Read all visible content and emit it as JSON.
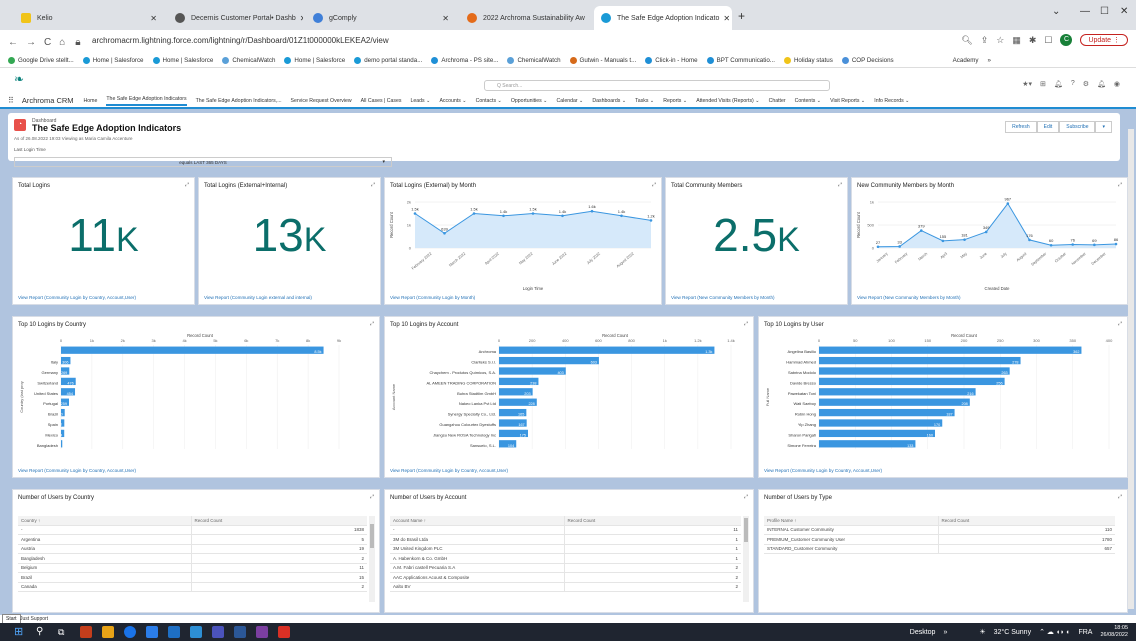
{
  "browser": {
    "tabs": [
      {
        "title": "Kelio",
        "icon": "kelio-icon",
        "color": "#f0c419"
      },
      {
        "title": "Decernis Customer Portal• Dashb",
        "icon": "decernis-icon",
        "color": "#555555"
      },
      {
        "title": "gComply",
        "icon": "gcomply-icon",
        "color": "#3f7fd8"
      },
      {
        "title": "2022 Archroma Sustainability Aw",
        "icon": "archroma-award-icon",
        "color": "#e46b1a"
      },
      {
        "title": "The Safe Edge Adoption Indicato",
        "icon": "salesforce-icon",
        "color": "#1a9ad6"
      }
    ],
    "url": "archromacrm.lightning.force.com/lightning/r/Dashboard/01Z1t000000kLEKEA2/view",
    "update_label": "Update",
    "profile_initial": "C",
    "bookmarks": [
      {
        "label": "Google Drive stellt...",
        "color": "#34a853"
      },
      {
        "label": "Home | Salesforce",
        "color": "#1a9ad6"
      },
      {
        "label": "Home | Salesforce",
        "color": "#1a9ad6"
      },
      {
        "label": "ChemicalWatch",
        "color": "#5aa0d8"
      },
      {
        "label": "Home | Salesforce",
        "color": "#1a9ad6"
      },
      {
        "label": "demo portal standa...",
        "color": "#1a9ad6"
      },
      {
        "label": "Archroma - PS site...",
        "color": "#1f8fd6"
      },
      {
        "label": "ChemicalWatch",
        "color": "#5aa0d8"
      },
      {
        "label": "Gutwin - Manuals t...",
        "color": "#d66a1a"
      },
      {
        "label": "Click-in - Home",
        "color": "#1f8fd6"
      },
      {
        "label": "BPT Communicatio...",
        "color": "#1f8fd6"
      },
      {
        "label": "Holiday status",
        "color": "#f0c419"
      },
      {
        "label": "COP Decisions",
        "color": "#4a90d9"
      },
      {
        "label": "Academy",
        "color": "#ffffff"
      }
    ]
  },
  "crm": {
    "search_placeholder": "Q Search...",
    "app_name": "Archroma CRM",
    "nav": [
      "Home",
      "The Safe Edge Adoption Indicators",
      "The Safe Edge Adoption Indicators,...",
      "Service Request Overview",
      "All Cases | Cases",
      "Leads",
      "Accounts",
      "Contacts",
      "Opportunities",
      "Calendar",
      "Dashboards",
      "Tasks",
      "Reports",
      "Attended Visits (Reports)",
      "Chatter",
      "Contents",
      "Visit Reports",
      "Info Records"
    ]
  },
  "dashboard": {
    "kicker": "Dashboard",
    "title": "The Safe Edge Adoption Indicators",
    "subtitle": "As of 26.08.2022 19:03 Viewing as Maria Camila Accenture",
    "filter_label": "Last Login Time",
    "filter_value": "equals LAST 365 DAYS",
    "buttons": [
      "Refresh",
      "Edit",
      "Subscribe"
    ]
  },
  "kpis": [
    {
      "title": "Total Logins",
      "value": "11",
      "unit": "K",
      "link": "View Report (Community Login by Country, Account,User)"
    },
    {
      "title": "Total Logins (External+Internal)",
      "value": "13",
      "unit": "K",
      "link": "View Report (Community Login external and internal)"
    },
    {
      "title": "Total Community Members",
      "value": "2.5",
      "unit": "K",
      "link": "View Report (New Community Members by Month)"
    }
  ],
  "chart_data": [
    {
      "type": "area",
      "title": "Total Logins (External) by Month",
      "xlabel": "Login Time",
      "ylabel": "Record Count",
      "ytick_labels": [
        "0",
        "1k",
        "2k"
      ],
      "categories": [
        "February 2022",
        "March 2022",
        "April 2022",
        "May 2022",
        "June 2022",
        "July 2022",
        "August 2022"
      ],
      "data_labels": [
        "1.5k",
        "639",
        "1.5k",
        "1.4k",
        "1.5k",
        "1.4k",
        "1.6k",
        "1.4k",
        "1.2k"
      ],
      "values": [
        1500,
        639,
        1500,
        1400,
        1500,
        1400,
        1600,
        1400,
        1200
      ],
      "ylim": [
        0,
        2000
      ],
      "link": "View Report (Community Login by Month)"
    },
    {
      "type": "area",
      "title": "New Community Members by Month",
      "xlabel": "Created Date",
      "ylabel": "Record Count",
      "ytick_labels": [
        "0",
        "500",
        "1k"
      ],
      "categories": [
        "January",
        "February",
        "March",
        "April",
        "May",
        "June",
        "July",
        "August",
        "September",
        "October",
        "November",
        "December"
      ],
      "data_labels": [
        "27",
        "33",
        "379",
        "155",
        "181",
        "349",
        "967",
        "176",
        "60",
        "76",
        "69",
        "86"
      ],
      "values": [
        27,
        33,
        379,
        155,
        181,
        349,
        967,
        176,
        60,
        76,
        69,
        86
      ],
      "ylim": [
        0,
        1000
      ],
      "link": "View Report (New Community Members by Month)"
    },
    {
      "type": "bar",
      "orientation": "horizontal",
      "title": "Top 10 Logins by Country",
      "xlabel": "Record Count",
      "ylabel": "Country (last proy",
      "xtick_labels": [
        "0",
        "1k",
        "2k",
        "3k",
        "4k",
        "5k",
        "6k",
        "7k",
        "8k",
        "9k"
      ],
      "categories": [
        "",
        "Italy",
        "Germany",
        "Switzerland",
        "United States",
        "Portugal",
        "Brazil",
        "Spain",
        "Mexico",
        "Bangladesh"
      ],
      "data_labels": [
        "8.5k",
        "306",
        "269",
        "476",
        "454",
        "259",
        "120",
        "107",
        "104",
        "41"
      ],
      "values": [
        8500,
        306,
        269,
        476,
        454,
        259,
        120,
        107,
        104,
        41
      ],
      "xlim": [
        0,
        9000
      ],
      "link": "View Report (Community Login by Country, Account,User)"
    },
    {
      "type": "bar",
      "orientation": "horizontal",
      "title": "Top 10 Logins by Account",
      "xlabel": "Record Count",
      "ylabel": "Account Name",
      "xtick_labels": [
        "0",
        "200",
        "400",
        "600",
        "800",
        "1k",
        "1.2k",
        "1.4k"
      ],
      "categories": [
        "Archroma",
        "Clariteks S.r.l.",
        "Chaychem - Produtos Químicos, S.A.",
        "AL AMEEN TRADING CORPORATION",
        "Buhra Stadtlim GmbH",
        "Nakeo Lanka Pvt Ltd",
        "Synergy Specialty Co., Ltd.",
        "Guangzhou Colourtex Dyestuffs",
        "Jiangsu New ROSA Technology Inc",
        "Sansuelo, S.L."
      ],
      "data_labels": [
        "1.3k",
        "603",
        "403",
        "238",
        "203",
        "228",
        "165",
        "167",
        "175",
        "104"
      ],
      "values": [
        1300,
        603,
        403,
        238,
        203,
        228,
        165,
        167,
        175,
        104
      ],
      "xlim": [
        0,
        1400
      ],
      "link": "View Report (Community Login by Country, Account,User)"
    },
    {
      "type": "bar",
      "orientation": "horizontal",
      "title": "Top 10 Logins by User",
      "xlabel": "Record Count",
      "ylabel": "Full Name",
      "xtick_labels": [
        "0",
        "50",
        "100",
        "150",
        "200",
        "250",
        "300",
        "350",
        "400"
      ],
      "categories": [
        "Angelina Basilio",
        "Hammad Ahmed",
        "Sabrina Modolo",
        "Davide Bresso",
        "Pawekatan Toni",
        "Wati Saeboy",
        "Robin Hong",
        "Yip Zhang",
        "Sharon Parigati",
        "Simone Ferreira"
      ],
      "data_labels": [
        "362",
        "278",
        "263",
        "256",
        "216",
        "208",
        "187",
        "170",
        "160",
        "133"
      ],
      "values": [
        362,
        278,
        263,
        256,
        216,
        208,
        187,
        170,
        160,
        133
      ],
      "xlim": [
        0,
        400
      ],
      "link": "View Report (Community Login by Country, Account,User)"
    }
  ],
  "tables": [
    {
      "title": "Number of Users by Country",
      "headers": [
        "Country ↑",
        "Record Count"
      ],
      "rows": [
        [
          "-",
          "1838"
        ],
        [
          "Argentina",
          "5"
        ],
        [
          "Austria",
          "19"
        ],
        [
          "Bangladesh",
          "2"
        ],
        [
          "Belgium",
          "11"
        ],
        [
          "Brazil",
          "15"
        ],
        [
          "Canada",
          "2"
        ]
      ]
    },
    {
      "title": "Number of Users by Account",
      "headers": [
        "Account Name ↑",
        "Record Count"
      ],
      "rows": [
        [
          "-",
          "11"
        ],
        [
          "3M do Brasil Ltda",
          "1"
        ],
        [
          "3M United Kingdom PLC",
          "1"
        ],
        [
          "A. Habenkorn & Co. GmbH",
          "1"
        ],
        [
          "A.M. Fabri castell Pecuaria S.A",
          "2"
        ],
        [
          "AAC Applications Acoust & Composite",
          "2"
        ],
        [
          "Aalto BV",
          "2"
        ]
      ]
    },
    {
      "title": "Number of Users by Type",
      "headers": [
        "Profile Name ↑",
        "Record Count"
      ],
      "rows": [
        [
          "INTERNAL Customer Community",
          "110"
        ],
        [
          "PREMIUM_Customer Community User",
          "1780"
        ],
        [
          "STANDARD_Customer Community",
          "657"
        ]
      ]
    }
  ],
  "footer": {
    "start_tooltip": "Start",
    "status_text": "Just Support",
    "desktop_label": "Desktop",
    "weather": "32°C Sunny",
    "language": "FRA",
    "time": "18:05",
    "date": "26/08/2022"
  }
}
